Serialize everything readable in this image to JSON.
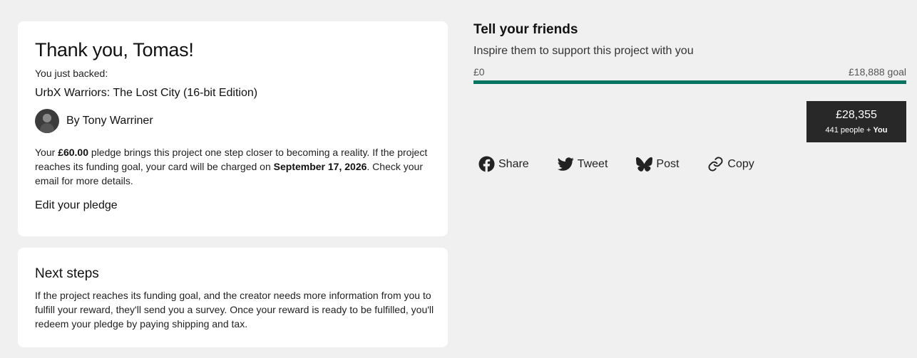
{
  "thanks_card": {
    "title": "Thank you, Tomas!",
    "backed_label": "You just backed:",
    "project_name": "UrbX Warriors: The Lost City (16-bit Edition)",
    "creator_prefix": "By",
    "creator_name": "Tony Warriner",
    "pledge_text_1": "Your ",
    "pledge_amount": "£60.00",
    "pledge_text_2": " pledge brings this project one step closer to becoming a reality. If the project reaches its funding goal, your card will be charged on ",
    "charge_date": "September 17, 2026",
    "pledge_text_3": ". Check your email for more details.",
    "edit_link": "Edit your pledge"
  },
  "next_steps": {
    "title": "Next steps",
    "text": "If the project reaches its funding goal, and the creator needs more information from you to fulfill your reward, they'll send you a survey. Once your reward is ready to be fulfilled, you'll redeem your pledge by paying shipping and tax."
  },
  "share": {
    "title": "Tell your friends",
    "subtitle": "Inspire them to support this project with you",
    "progress_start": "£0",
    "progress_goal": "£18,888 goal",
    "progress_fraction": 1.0,
    "accent_color": "#037362",
    "pledged_amount": "£28,355",
    "backers_text": "441 people + ",
    "backers_you": "You",
    "buttons": {
      "share": {
        "label": "Share",
        "icon": "facebook-icon"
      },
      "tweet": {
        "label": "Tweet",
        "icon": "twitter-icon"
      },
      "post": {
        "label": "Post",
        "icon": "bluesky-icon"
      },
      "copy": {
        "label": "Copy",
        "icon": "link-icon"
      }
    }
  }
}
